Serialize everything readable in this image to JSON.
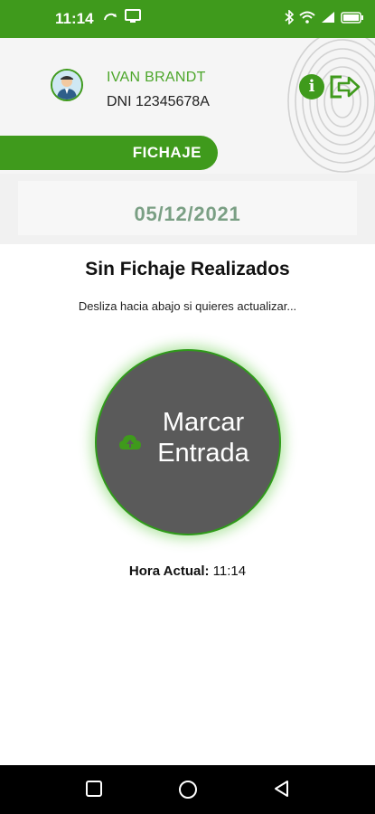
{
  "status_bar": {
    "time": "11:14",
    "icons": [
      "cast-icon",
      "screen-icon",
      "bluetooth-icon",
      "wifi-icon",
      "signal-icon",
      "battery-icon"
    ],
    "color": "#3f9a1c"
  },
  "header": {
    "user_name": "IVAN BRANDT",
    "user_dni": "DNI 12345678A",
    "info_icon": "i"
  },
  "tab": {
    "label": "FICHAJE"
  },
  "date": "05/12/2021",
  "main": {
    "title": "Sin Fichaje Realizados",
    "hint": "Desliza hacia abajo si quieres actualizar...",
    "punch_button_label": "Marcar Entrada",
    "current_time_label": "Hora Actual:",
    "current_time_value": "11:14"
  },
  "nav": {
    "items": [
      "recents-button",
      "home-button",
      "back-button"
    ]
  },
  "colors": {
    "accent": "#3f9a1c",
    "date": "#7a9f84",
    "button": "#5a5a5a"
  }
}
